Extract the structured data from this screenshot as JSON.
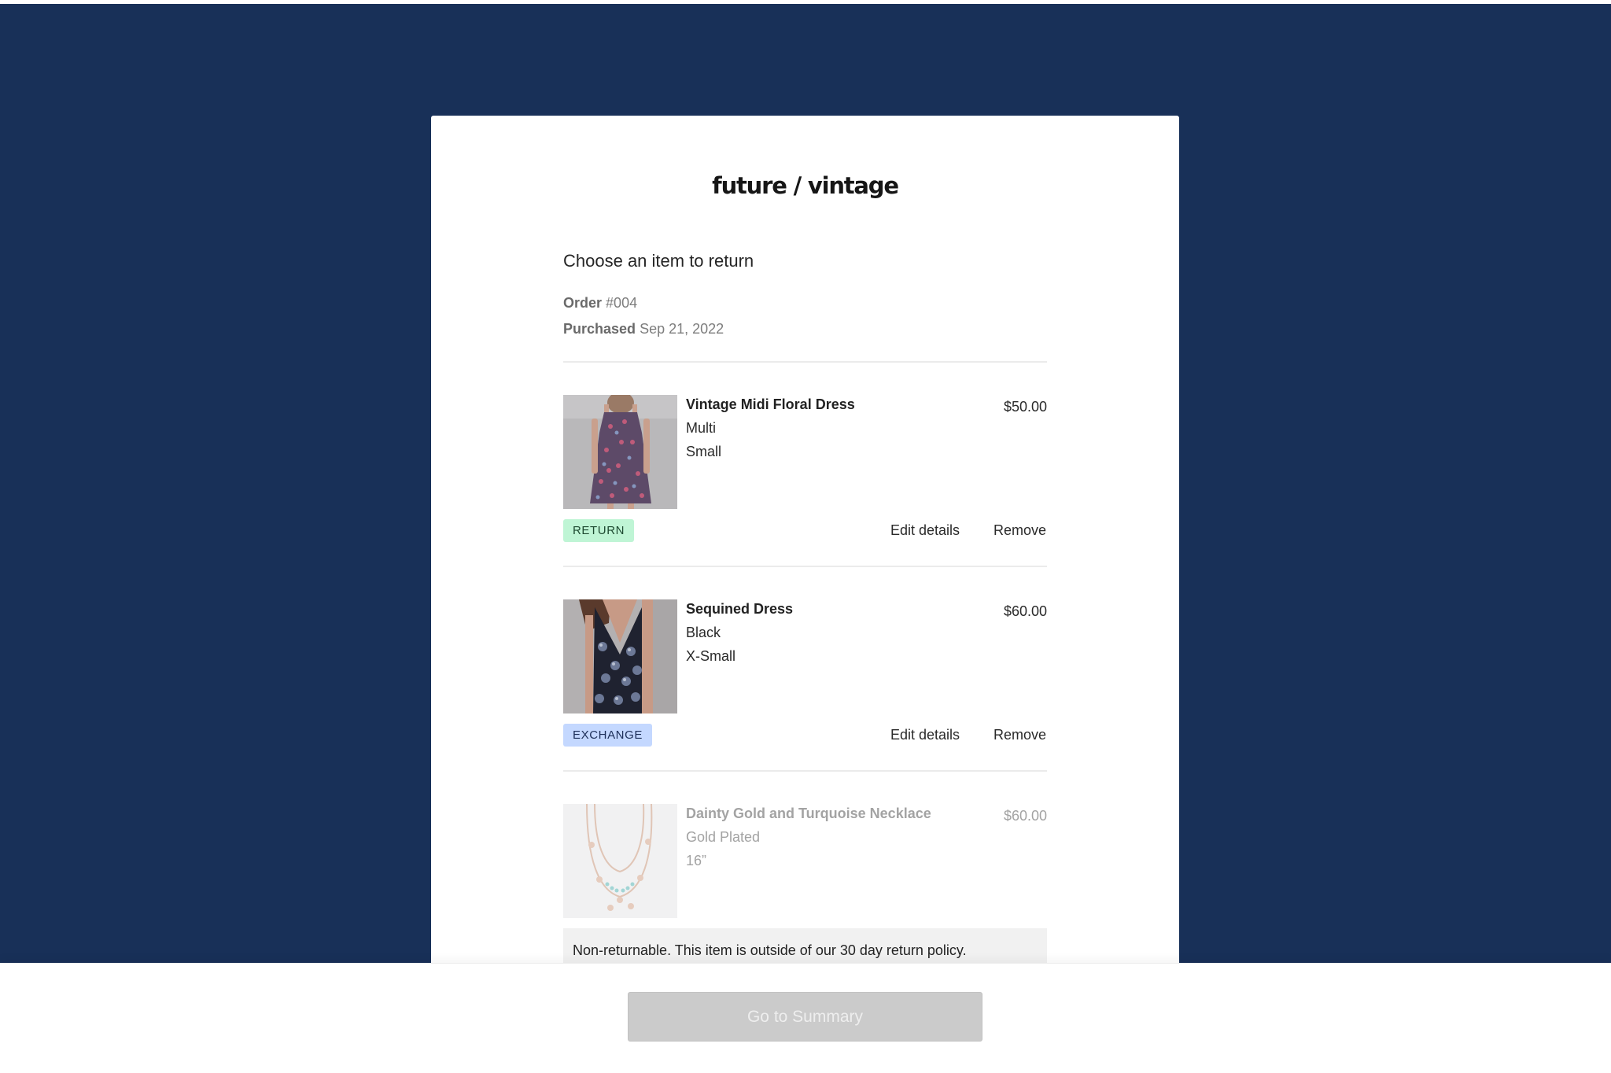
{
  "brand": {
    "logo_text": "future / vintage"
  },
  "page": {
    "heading": "Choose an item to return",
    "order_label": "Order",
    "order_number": "#004",
    "purchased_label": "Purchased",
    "purchased_date": "Sep 21, 2022"
  },
  "items": [
    {
      "name": "Vintage Midi Floral Dress",
      "color": "Multi",
      "size": "Small",
      "price": "$50.00",
      "badge": "RETURN",
      "edit_label": "Edit details",
      "remove_label": "Remove",
      "image_icon": "floral-dress-photo"
    },
    {
      "name": "Sequined Dress",
      "color": "Black",
      "size": "X-Small",
      "price": "$60.00",
      "badge": "EXCHANGE",
      "edit_label": "Edit details",
      "remove_label": "Remove",
      "image_icon": "sequined-dress-photo"
    },
    {
      "name": "Dainty Gold and Turquoise Necklace",
      "color": "Gold Plated",
      "size": "16”",
      "price": "$60.00",
      "notice": "Non-returnable. This item is outside of our 30 day return policy.",
      "image_icon": "necklace-photo"
    }
  ],
  "footer": {
    "summary_button_label": "Go to Summary"
  },
  "colors": {
    "backdrop": "#183058",
    "return_badge": "#bff5d5",
    "exchange_badge": "#c4d8ff",
    "disabled_button": "#cbcbcb"
  }
}
